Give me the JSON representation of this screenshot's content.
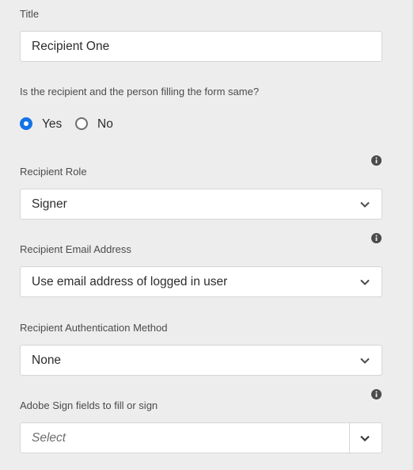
{
  "title_field": {
    "label": "Title",
    "value": "Recipient One"
  },
  "same_person": {
    "question": "Is the recipient and the person filling the form same?",
    "options": [
      {
        "label": "Yes",
        "checked": true
      },
      {
        "label": "No",
        "checked": false
      }
    ]
  },
  "recipient_role": {
    "label": "Recipient Role",
    "selected": "Signer"
  },
  "recipient_email": {
    "label": "Recipient Email Address",
    "selected": "Use email address of logged in user"
  },
  "auth_method": {
    "label": "Recipient Authentication Method",
    "selected": "None"
  },
  "sign_fields": {
    "label": "Adobe Sign fields to fill or sign",
    "placeholder": "Select"
  },
  "colors": {
    "accent": "#1473e6",
    "panel_background": "#ededed"
  },
  "icons": {
    "info": "info-icon",
    "dropdown": "chevron-down-icon"
  }
}
